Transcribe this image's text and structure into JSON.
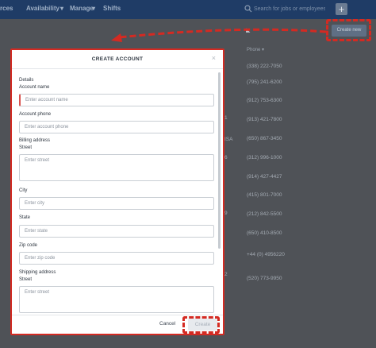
{
  "nav": {
    "items": [
      "rces",
      "Availability",
      "Manage",
      "Shifts"
    ],
    "search_placeholder": "Search for jobs or employees",
    "plus_label": "+"
  },
  "background": {
    "create_new_label": "Create new",
    "marker": "◣",
    "phone_header": "Phone",
    "phones": [
      "(338) 222-7050",
      "(795) 241-6200",
      "(912) 753-6300",
      "(913) 421-7800",
      "(650) 867-3450",
      "(312) 996-1000",
      "(914) 427-4427",
      "(415) 801-7000",
      "(212) 842-5500",
      "(650) 410-8500",
      "+44 (0) 4956220",
      "(520) 773-9950"
    ],
    "left_fragments": [
      "1",
      "ISA",
      "6",
      "9",
      "2"
    ]
  },
  "modal": {
    "title": "CREATE ACCOUNT",
    "close_label": "×",
    "details_label": "Details",
    "account_name_label": "Account name",
    "account_name_placeholder": "Enter account name",
    "account_phone_label": "Account phone",
    "account_phone_placeholder": "Enter account phone",
    "billing_label": "Billing address",
    "street_label": "Street",
    "street_placeholder": "Enter street",
    "city_label": "City",
    "city_placeholder": "Enter city",
    "state_label": "State",
    "state_placeholder": "Enter state",
    "zip_label": "Zip code",
    "zip_placeholder": "Enter zip code",
    "shipping_label": "Shipping address",
    "shipping_street_label": "Street",
    "shipping_street_placeholder": "Enter street",
    "cancel_label": "Cancel",
    "create_label": "Create"
  },
  "colors": {
    "nav_bg": "#1f3c66",
    "annotation_red": "#d42a22",
    "overlay": "#4f5257"
  }
}
